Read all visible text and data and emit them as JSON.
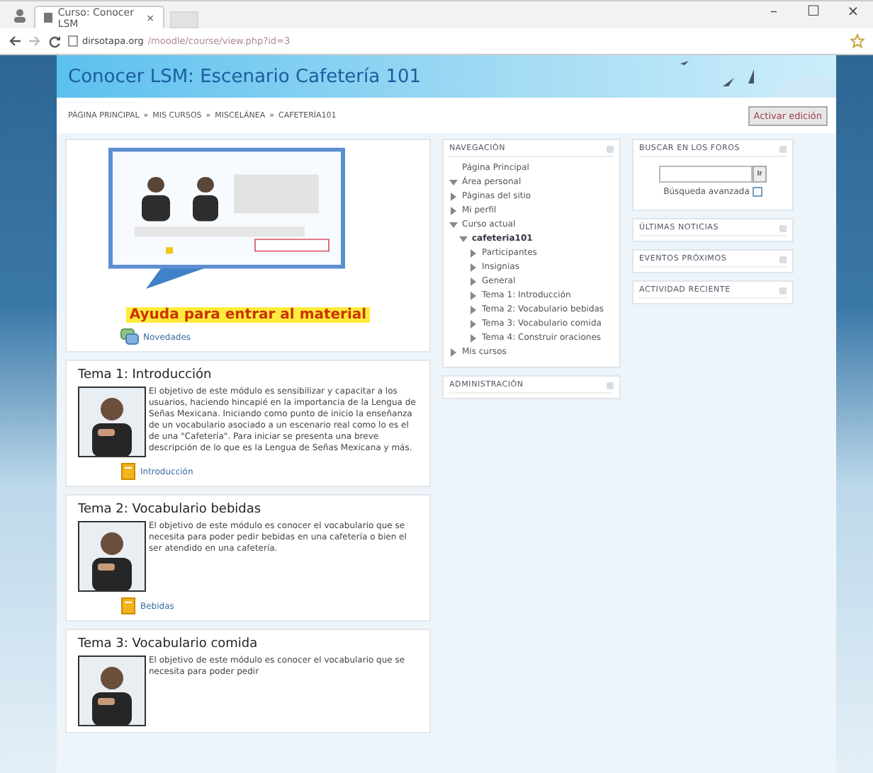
{
  "browser": {
    "tab_title": "Curso: Conocer LSM",
    "tab_close": "×",
    "url_host": "dirsotapa.org",
    "url_path": "/moodle/course/view.php?id=3"
  },
  "window_controls": [
    "–",
    "☐",
    "×"
  ],
  "header": {
    "title": "Conocer LSM: Escenario Cafetería 101"
  },
  "breadcrumb": [
    "PÁGINA PRINCIPAL",
    "MIS CURSOS",
    "MISCELÁNEA",
    "CAFETERÍA101"
  ],
  "breadcrumb_separator": "»",
  "edit_button": "Activar edición",
  "help": {
    "heading": "Ayuda para entrar al material",
    "link": "Novedades"
  },
  "topics": [
    {
      "title": "Tema 1: Introducción",
      "text": "El objetivo de este módulo es sensibilizar y capacitar a los usuarios, haciendo hincapié en la importancia de la Lengua de Señas Mexicana. Iniciando como punto de inicio la enseñanza de un vocabulario asociado a un escenario real como lo es el de una \"Cafetería\". Para iniciar se presenta una breve descripción de lo que es la Lengua de Señas Mexicana y más.",
      "link": "Introducción"
    },
    {
      "title": "Tema 2: Vocabulario bebidas",
      "text": "El objetivo de este módulo es conocer el vocabulario que se necesita para poder pedir bebidas en una cafetería o bien el ser atendido en una cafetería.",
      "link": "Bebidas"
    },
    {
      "title": "Tema 3: Vocabulario comida",
      "text": "El objetivo de este módulo es conocer el vocabulario que se necesita para poder pedir"
    }
  ],
  "navigation": {
    "title": "NAVEGACIÓN",
    "items": [
      {
        "label": "Página Principal",
        "kind": "link"
      },
      {
        "label": "Área personal",
        "kind": "branch",
        "expanded": true
      },
      {
        "label": "Páginas del sitio",
        "kind": "branch",
        "expanded": false
      },
      {
        "label": "Mi perfil",
        "kind": "branch",
        "expanded": false
      },
      {
        "label": "Curso actual",
        "kind": "branch",
        "expanded": true,
        "children": [
          {
            "label": "cafeteria101",
            "kind": "current",
            "expanded": true,
            "children": [
              {
                "label": "Participantes",
                "kind": "branch",
                "expanded": false
              },
              {
                "label": "Insignias",
                "kind": "branch",
                "expanded": false
              },
              {
                "label": "General",
                "kind": "branch",
                "expanded": false
              },
              {
                "label": "Tema 1: Introducción",
                "kind": "branch",
                "expanded": false
              },
              {
                "label": "Tema 2: Vocabulario bebidas",
                "kind": "branch",
                "expanded": false
              },
              {
                "label": "Tema 3: Vocabulario comida",
                "kind": "branch",
                "expanded": false
              },
              {
                "label": "Tema 4: Construir oraciones",
                "kind": "branch",
                "expanded": false
              }
            ]
          }
        ]
      },
      {
        "label": "Mis cursos",
        "kind": "branch",
        "expanded": false
      }
    ]
  },
  "administration": {
    "title": "ADMINISTRACIÓN"
  },
  "forum_search": {
    "title": "BUSCAR EN LOS FOROS",
    "go": "Ir",
    "advanced": "Búsqueda avanzada"
  },
  "blocks": [
    "ÚLTIMAS NOTICIAS",
    "EVENTOS PRÓXIMOS",
    "ACTIVIDAD RECIENTE"
  ]
}
